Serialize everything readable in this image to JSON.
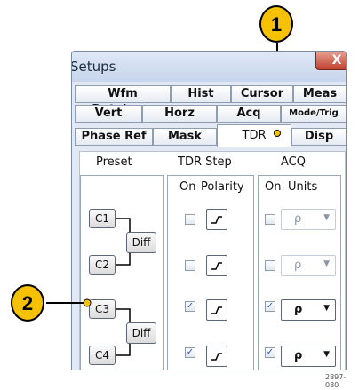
{
  "window": {
    "title": "Setups",
    "close_glyph": "X"
  },
  "tabs": {
    "row1": [
      "Wfm Database",
      "Hist",
      "Cursor",
      "Meas"
    ],
    "row2": [
      "Vert",
      "Horz",
      "Acq",
      "Mode/Trig"
    ],
    "row3": [
      "Phase Ref",
      "Mask",
      "TDR",
      "Disp"
    ],
    "active": "TDR"
  },
  "headers": {
    "preset": "Preset",
    "tdr_step": "TDR Step",
    "acq": "ACQ",
    "on": "On",
    "polarity": "Polarity",
    "acq_on": "On",
    "units": "Units"
  },
  "channels": [
    {
      "name": "C1",
      "step_on": false,
      "acq_on": false,
      "units": "ρ",
      "units_enabled": false
    },
    {
      "name": "C2",
      "step_on": false,
      "acq_on": false,
      "units": "ρ",
      "units_enabled": false
    },
    {
      "name": "C3",
      "step_on": true,
      "acq_on": true,
      "units": "ρ",
      "units_enabled": true
    },
    {
      "name": "C4",
      "step_on": true,
      "acq_on": true,
      "units": "ρ",
      "units_enabled": true
    }
  ],
  "diff_label": "Diff",
  "callouts": [
    "1",
    "2"
  ],
  "caption": "2897-080",
  "icons": {
    "checkmark": "✓",
    "dropdown": "▼",
    "step": "step-icon"
  }
}
